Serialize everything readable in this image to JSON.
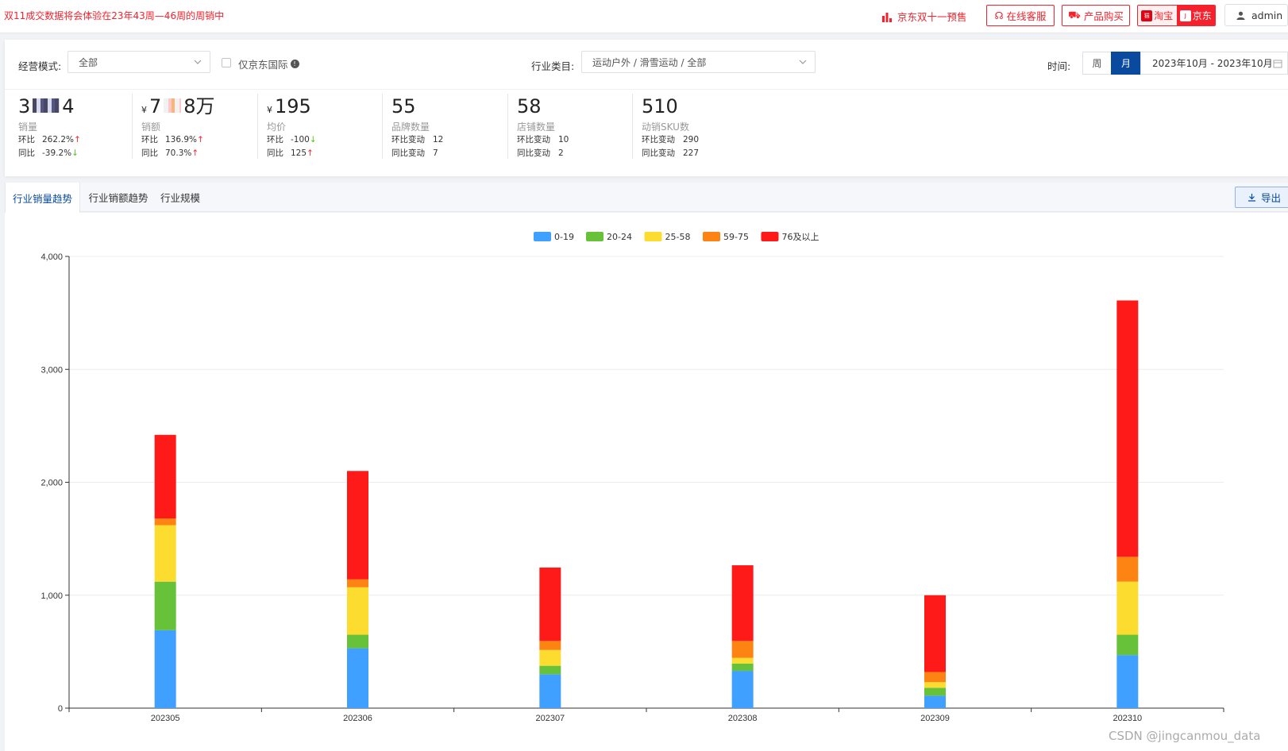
{
  "topbar": {
    "notice": "双11成交数据将会体验在23年43周—46周的周销中",
    "promo": "京东双十一预售",
    "service_btn": "在线客服",
    "buy_btn": "产品购买",
    "platform_taobao": "淘宝",
    "platform_jd": "京东",
    "user": "admin"
  },
  "filters": {
    "mode_label": "经营模式:",
    "mode_value": "全部",
    "intl_label": "仅京东国际",
    "category_label": "行业类目:",
    "category_value": "运动户外 / 滑雪运动 / 全部",
    "time_label": "时间:",
    "week": "周",
    "month": "月",
    "date_range": "2023年10月 - 2023年10月"
  },
  "kpis": [
    {
      "value_prefix": "3",
      "value_suffix": "4",
      "currency": "",
      "label": "销量",
      "r1_key": "环比",
      "r1_val": "262.2%",
      "r1_dir": "up",
      "r2_key": "同比",
      "r2_val": "-39.2%",
      "r2_dir": "down"
    },
    {
      "value_prefix": "7",
      "value_suffix": "8万",
      "currency": "¥",
      "label": "销额",
      "r1_key": "环比",
      "r1_val": "136.9%",
      "r1_dir": "up",
      "r2_key": "同比",
      "r2_val": "70.3%",
      "r2_dir": "up"
    },
    {
      "value": "195",
      "currency": "¥",
      "label": "均价",
      "r1_key": "环比",
      "r1_val": "-100",
      "r1_dir": "down",
      "r2_key": "同比",
      "r2_val": "125",
      "r2_dir": "up"
    },
    {
      "value": "55",
      "label": "品牌数量",
      "r1_key": "环比变动",
      "r1_val": "12",
      "r2_key": "同比变动",
      "r2_val": "7"
    },
    {
      "value": "58",
      "label": "店铺数量",
      "r1_key": "环比变动",
      "r1_val": "10",
      "r2_key": "同比变动",
      "r2_val": "2"
    },
    {
      "value": "510",
      "label": "动销SKU数",
      "r1_key": "环比变动",
      "r1_val": "290",
      "r2_key": "同比变动",
      "r2_val": "227"
    }
  ],
  "tabs": [
    "行业销量趋势",
    "行业销额趋势",
    "行业规模"
  ],
  "export": "导出",
  "watermark": "CSDN @jingcanmou_data",
  "chart_data": {
    "type": "bar",
    "stacked": true,
    "categories": [
      "202305",
      "202306",
      "202307",
      "202308",
      "202309",
      "202310"
    ],
    "ylim": [
      0,
      4000
    ],
    "yticks": [
      0,
      1000,
      2000,
      3000,
      4000
    ],
    "ytick_labels": [
      "0",
      "1,000",
      "2,000",
      "3,000",
      "4,000"
    ],
    "legend_position": "top-center",
    "grid": true,
    "series": [
      {
        "name": "0-19",
        "color": "#40a0ff",
        "values": [
          690,
          530,
          300,
          330,
          110,
          470
        ]
      },
      {
        "name": "20-24",
        "color": "#67c23a",
        "values": [
          430,
          120,
          75,
          65,
          70,
          180
        ]
      },
      {
        "name": "25-58",
        "color": "#fcdc2f",
        "values": [
          500,
          420,
          140,
          50,
          50,
          470
        ]
      },
      {
        "name": "59-75",
        "color": "#fd8412",
        "values": [
          60,
          70,
          80,
          150,
          90,
          220
        ]
      },
      {
        "name": "76及以上",
        "color": "#ff1a1a",
        "values": [
          740,
          960,
          650,
          670,
          680,
          2270
        ]
      }
    ]
  }
}
